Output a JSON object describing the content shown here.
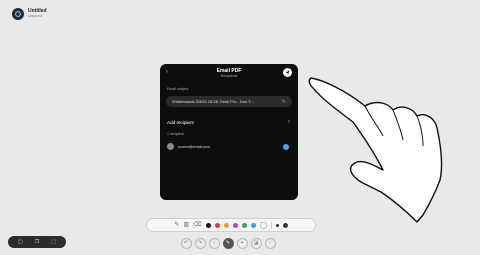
{
  "document": {
    "title": "Untitled",
    "subtitle": "Unsaved"
  },
  "dialog": {
    "title": "Email PDF",
    "subtitle": "Recipients",
    "subject_label": "Email subject",
    "subject_value": "Whiteboards 3/3/20 15:28, Desk Pro - Doe T...",
    "add_recipient_label": "Add recipient",
    "recipient_count_label": "1 recipient",
    "recipients": [
      {
        "email": "ucorte@email.com"
      }
    ]
  },
  "toolbar": {
    "colors": [
      "#111111",
      "#e23a2e",
      "#f0a020",
      "#c23bc0",
      "#34a853",
      "#3b9de0",
      "#ffffff"
    ]
  },
  "icons": {
    "badge": "whiteboard-icon",
    "send": "send-icon",
    "back": "back-icon",
    "edit": "pencil-icon",
    "chevron": "chevron-right-icon"
  }
}
